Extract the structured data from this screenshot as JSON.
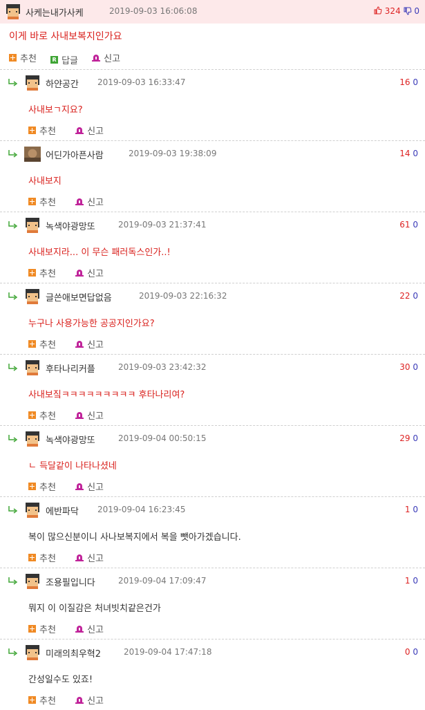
{
  "post": {
    "nickname": "사케는내가사케",
    "date": "2019-09-03 16:06:08",
    "upvotes": "324",
    "downvotes": "0",
    "text": "이게 바로 사내보복지인가요",
    "actions": {
      "recommend": "추천",
      "reply": "답글",
      "report": "신고"
    },
    "icons": {
      "recommend": "plus-icon",
      "reply": "reply-r-icon",
      "report": "siren-icon",
      "upvote": "thumbs-up-icon",
      "downvote": "thumbs-down-icon"
    }
  },
  "comments": [
    {
      "nickname": "하얀공간",
      "date": "2019-09-03 16:33:47",
      "up": "16",
      "down": "0",
      "text": "사내보ㄱ지요?",
      "text_color": "red",
      "avatar": "pixel-avatar"
    },
    {
      "nickname": "어딘가아픈사람",
      "date": "2019-09-03 19:38:09",
      "up": "14",
      "down": "0",
      "text": "사내보지",
      "text_color": "red",
      "avatar": "photo-avatar"
    },
    {
      "nickname": "녹색야광망또",
      "date": "2019-09-03 21:37:41",
      "up": "61",
      "down": "0",
      "text": "사내보지라... 이 무슨 패러독스인가..!",
      "text_color": "red",
      "avatar": "pixel-avatar"
    },
    {
      "nickname": "글쓴애보면답없음",
      "date": "2019-09-03 22:16:32",
      "up": "22",
      "down": "0",
      "text": "누구나 사용가능한 공공지인가요?",
      "text_color": "red",
      "avatar": "pixel-avatar"
    },
    {
      "nickname": "후타나리커플",
      "date": "2019-09-03 23:42:32",
      "up": "30",
      "down": "0",
      "text": "사내보짘ㅋㅋㅋㅋㅋㅋㅋㅋㅋ 후타나리여?",
      "text_color": "red",
      "avatar": "pixel-avatar"
    },
    {
      "nickname": "녹색야광망또",
      "date": "2019-09-04 00:50:15",
      "up": "29",
      "down": "0",
      "text": "ㄴ 득달같이 나타나셨네",
      "text_color": "red",
      "avatar": "pixel-avatar"
    },
    {
      "nickname": "에반파닥",
      "date": "2019-09-04 16:23:45",
      "up": "1",
      "down": "0",
      "text": "복이 많으신분이니 사나보복지에서 복을 뺏아가겠습니다.",
      "text_color": "dark",
      "avatar": "pixel-avatar"
    },
    {
      "nickname": "조용필입니다",
      "date": "2019-09-04 17:09:47",
      "up": "1",
      "down": "0",
      "text": "뭐지 이 이질감은 처녀빗치같은건가",
      "text_color": "dark",
      "avatar": "pixel-avatar"
    },
    {
      "nickname": "미래의최우혁2",
      "date": "2019-09-04 17:47:18",
      "up": "0",
      "down": "0",
      "text": "간성일수도 있죠!",
      "text_color": "dark",
      "avatar": "pixel-avatar"
    }
  ],
  "comment_actions": {
    "recommend": "추천",
    "report": "신고"
  },
  "colors": {
    "header_bg": "#fde9ea",
    "accent_red": "#d9201c",
    "vote_down": "#3a3ab8",
    "recommend_icon": "#f08a24",
    "reply_icon": "#3fa535",
    "report_icon": "#c0249a"
  }
}
